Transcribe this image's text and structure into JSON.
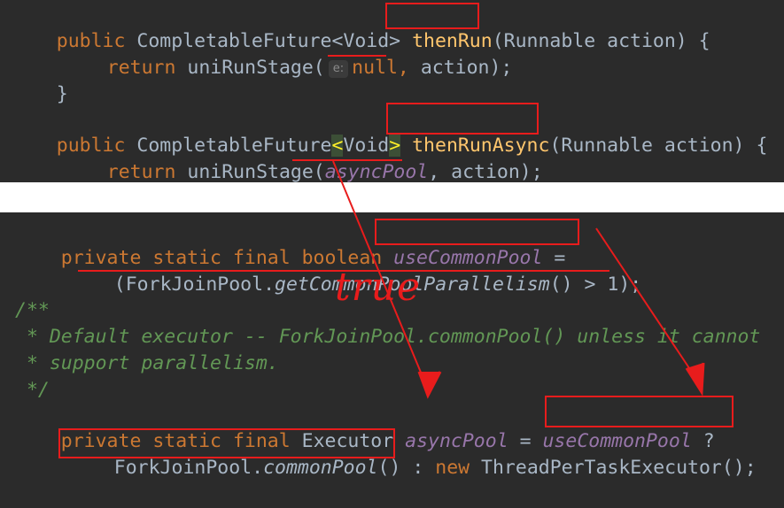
{
  "snippet_top": {
    "then_run": {
      "modifier": "public",
      "return_type": "CompletableFuture<Void>",
      "method_name": "thenRun",
      "params": "(Runnable action) {",
      "body_return": "return",
      "body_call": "uniRunStage(",
      "param_hint": "e:",
      "null_arg": "null,",
      "body_rest": " action);",
      "close": "}"
    },
    "then_run_async": {
      "modifier": "public",
      "return_type_name": "CompletableFuture",
      "generic_open": "<",
      "generic_type": "Void",
      "generic_close": ">",
      "method_name": "thenRunAsync",
      "params": "(Runnable action) {",
      "body_return": "return",
      "body_call": "uniRunStage(",
      "pool_arg": "asyncPool",
      "body_rest": ", action);",
      "close": "}"
    }
  },
  "snippet_bottom": {
    "field_decl": {
      "modifiers": "private static final boolean",
      "field_name": "useCommonPool",
      "assign": " =",
      "expr_open": "(",
      "expr_class": "ForkJoinPool.",
      "expr_method": "getCommonPoolParallelism",
      "expr_rest": "() > 1);"
    },
    "doc_comment": [
      "/**",
      " * Default executor -- ForkJoinPool.commonPool() unless it cannot",
      " * support parallelism.",
      " */"
    ],
    "executor_decl": {
      "modifiers": "private static final",
      "type": "Executor",
      "field_name": "asyncPool",
      "assign": " = ",
      "condition": "useCommonPool",
      "ternary_q": " ?",
      "common_class": "ForkJoinPool.",
      "common_method": "commonPool",
      "common_paren": "()",
      "ternary_colon": " : ",
      "new_kw": "new",
      "fallback": " ThreadPerTaskExecutor();"
    }
  },
  "handwritten_annotation": "true",
  "annotation_color": "#e81c1c"
}
